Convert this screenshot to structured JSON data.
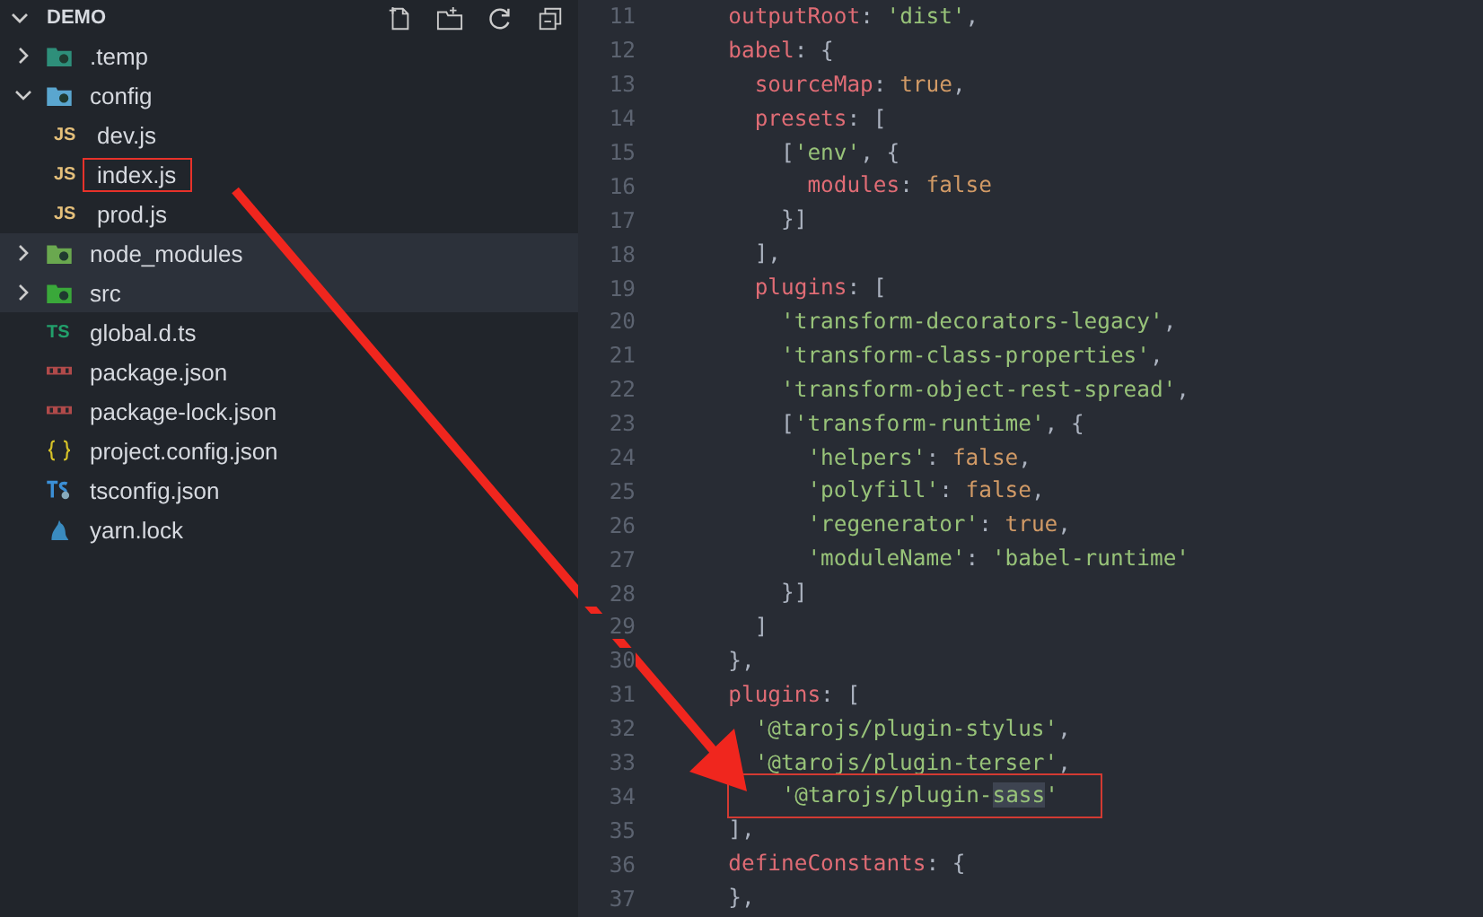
{
  "explorer": {
    "title": "DEMO",
    "expanded": true,
    "items": [
      {
        "label": ".temp",
        "kind": "folder-clock",
        "expanded": false,
        "selected": false,
        "highlighted": false
      },
      {
        "label": "config",
        "kind": "folder-config",
        "expanded": true,
        "selected": false,
        "highlighted": false,
        "children": [
          {
            "label": "dev.js",
            "kind": "js",
            "badge": "JS",
            "selected": false,
            "highlighted": false
          },
          {
            "label": "index.js",
            "kind": "js",
            "badge": "JS",
            "selected": false,
            "highlighted": true
          },
          {
            "label": "prod.js",
            "kind": "js",
            "badge": "JS",
            "selected": false,
            "highlighted": false
          }
        ]
      },
      {
        "label": "node_modules",
        "kind": "folder-node",
        "expanded": false,
        "selected": true,
        "highlighted": false
      },
      {
        "label": "src",
        "kind": "folder-src",
        "expanded": false,
        "selected": true,
        "highlighted": false
      },
      {
        "label": "global.d.ts",
        "kind": "ts",
        "badge": "TS",
        "selected": false,
        "highlighted": false
      },
      {
        "label": "package.json",
        "kind": "npm",
        "selected": false,
        "highlighted": false
      },
      {
        "label": "package-lock.json",
        "kind": "npm",
        "selected": false,
        "highlighted": false
      },
      {
        "label": "project.config.json",
        "kind": "json",
        "selected": false,
        "highlighted": false
      },
      {
        "label": "tsconfig.json",
        "kind": "tsconfig",
        "selected": false,
        "highlighted": false
      },
      {
        "label": "yarn.lock",
        "kind": "yarn",
        "selected": false,
        "highlighted": false
      }
    ]
  },
  "editor": {
    "lines": [
      {
        "number": "11",
        "highlighted": false,
        "tokens": [
          {
            "kind": "key",
            "text": "  outputRoot"
          },
          {
            "kind": "punct",
            "text": ": "
          },
          {
            "kind": "str",
            "text": "'dist'"
          },
          {
            "kind": "punct",
            "text": ","
          }
        ]
      },
      {
        "number": "12",
        "highlighted": false,
        "tokens": [
          {
            "kind": "key",
            "text": "  babel"
          },
          {
            "kind": "punct",
            "text": ": {"
          }
        ]
      },
      {
        "number": "13",
        "highlighted": false,
        "tokens": [
          {
            "kind": "key",
            "text": "    sourceMap"
          },
          {
            "kind": "punct",
            "text": ": "
          },
          {
            "kind": "bool",
            "text": "true"
          },
          {
            "kind": "punct",
            "text": ","
          }
        ]
      },
      {
        "number": "14",
        "highlighted": false,
        "tokens": [
          {
            "kind": "key",
            "text": "    presets"
          },
          {
            "kind": "punct",
            "text": ": ["
          }
        ]
      },
      {
        "number": "15",
        "highlighted": false,
        "tokens": [
          {
            "kind": "punct",
            "text": "      ["
          },
          {
            "kind": "str",
            "text": "'env'"
          },
          {
            "kind": "punct",
            "text": ", {"
          }
        ]
      },
      {
        "number": "16",
        "highlighted": false,
        "tokens": [
          {
            "kind": "key",
            "text": "        modules"
          },
          {
            "kind": "punct",
            "text": ": "
          },
          {
            "kind": "bool",
            "text": "false"
          }
        ]
      },
      {
        "number": "17",
        "highlighted": false,
        "tokens": [
          {
            "kind": "punct",
            "text": "      }]"
          }
        ]
      },
      {
        "number": "18",
        "highlighted": false,
        "tokens": [
          {
            "kind": "punct",
            "text": "    ],"
          }
        ]
      },
      {
        "number": "19",
        "highlighted": false,
        "tokens": [
          {
            "kind": "key",
            "text": "    plugins"
          },
          {
            "kind": "punct",
            "text": ": ["
          }
        ]
      },
      {
        "number": "20",
        "highlighted": false,
        "tokens": [
          {
            "kind": "str",
            "text": "      'transform-decorators-legacy'"
          },
          {
            "kind": "punct",
            "text": ","
          }
        ]
      },
      {
        "number": "21",
        "highlighted": false,
        "tokens": [
          {
            "kind": "str",
            "text": "      'transform-class-properties'"
          },
          {
            "kind": "punct",
            "text": ","
          }
        ]
      },
      {
        "number": "22",
        "highlighted": false,
        "tokens": [
          {
            "kind": "str",
            "text": "      'transform-object-rest-spread'"
          },
          {
            "kind": "punct",
            "text": ","
          }
        ]
      },
      {
        "number": "23",
        "highlighted": false,
        "tokens": [
          {
            "kind": "punct",
            "text": "      ["
          },
          {
            "kind": "str",
            "text": "'transform-runtime'"
          },
          {
            "kind": "punct",
            "text": ", {"
          }
        ]
      },
      {
        "number": "24",
        "highlighted": false,
        "tokens": [
          {
            "kind": "str",
            "text": "        'helpers'"
          },
          {
            "kind": "punct",
            "text": ": "
          },
          {
            "kind": "bool",
            "text": "false"
          },
          {
            "kind": "punct",
            "text": ","
          }
        ]
      },
      {
        "number": "25",
        "highlighted": false,
        "tokens": [
          {
            "kind": "str",
            "text": "        'polyfill'"
          },
          {
            "kind": "punct",
            "text": ": "
          },
          {
            "kind": "bool",
            "text": "false"
          },
          {
            "kind": "punct",
            "text": ","
          }
        ]
      },
      {
        "number": "26",
        "highlighted": false,
        "tokens": [
          {
            "kind": "str",
            "text": "        'regenerator'"
          },
          {
            "kind": "punct",
            "text": ": "
          },
          {
            "kind": "bool",
            "text": "true"
          },
          {
            "kind": "punct",
            "text": ","
          }
        ]
      },
      {
        "number": "27",
        "highlighted": false,
        "tokens": [
          {
            "kind": "str",
            "text": "        'moduleName'"
          },
          {
            "kind": "punct",
            "text": ": "
          },
          {
            "kind": "str",
            "text": "'babel-runtime'"
          }
        ]
      },
      {
        "number": "28",
        "highlighted": false,
        "tokens": [
          {
            "kind": "punct",
            "text": "      }]"
          }
        ]
      },
      {
        "number": "29",
        "highlighted": false,
        "tokens": [
          {
            "kind": "punct",
            "text": "    ]"
          }
        ]
      },
      {
        "number": "30",
        "highlighted": false,
        "tokens": [
          {
            "kind": "punct",
            "text": "  },"
          }
        ]
      },
      {
        "number": "31",
        "highlighted": false,
        "tokens": [
          {
            "kind": "key",
            "text": "  plugins"
          },
          {
            "kind": "punct",
            "text": ": ["
          }
        ]
      },
      {
        "number": "32",
        "highlighted": false,
        "tokens": [
          {
            "kind": "str",
            "text": "    '@tarojs/plugin-stylus'"
          },
          {
            "kind": "punct",
            "text": ","
          }
        ]
      },
      {
        "number": "33",
        "highlighted": false,
        "tokens": [
          {
            "kind": "str",
            "text": "    '@tarojs/plugin-terser'"
          },
          {
            "kind": "punct",
            "text": ","
          }
        ]
      },
      {
        "number": "34",
        "highlighted": true,
        "tokens": [
          {
            "kind": "str",
            "text": "    '@tarojs/plugin-"
          },
          {
            "kind": "selection",
            "text": "sass"
          },
          {
            "kind": "str",
            "text": "'"
          }
        ]
      },
      {
        "number": "35",
        "highlighted": false,
        "tokens": [
          {
            "kind": "punct",
            "text": "  ],"
          }
        ]
      },
      {
        "number": "36",
        "highlighted": false,
        "tokens": [
          {
            "kind": "key",
            "text": "  defineConstants"
          },
          {
            "kind": "punct",
            "text": ": {"
          }
        ]
      },
      {
        "number": "37",
        "highlighted": false,
        "tokens": [
          {
            "kind": "punct",
            "text": "  },"
          }
        ]
      }
    ]
  }
}
